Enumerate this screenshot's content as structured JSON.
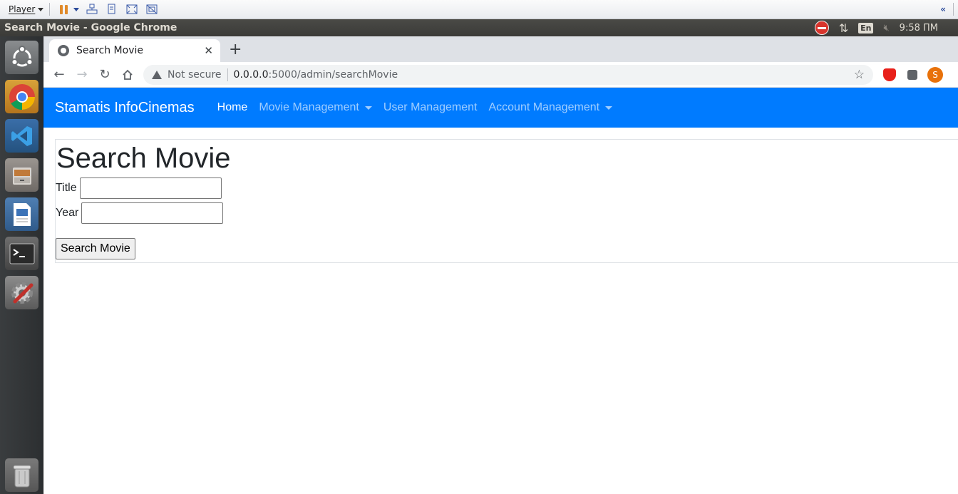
{
  "player": {
    "menu_label": "Player"
  },
  "topbar": {
    "window_title": "Search Movie - Google Chrome",
    "lang": "En",
    "clock": "9:58 ПМ"
  },
  "browser": {
    "tab_title": "Search Movie",
    "security_label": "Not secure",
    "url_host": "0.0.0.0",
    "url_rest": ":5000/admin/searchMovie",
    "profile_initial": "S"
  },
  "site": {
    "brand": "Stamatis InfoCinemas",
    "nav": [
      {
        "label": "Home",
        "active": true,
        "dropdown": false
      },
      {
        "label": "Movie Management",
        "active": false,
        "dropdown": true
      },
      {
        "label": "User Management",
        "active": false,
        "dropdown": false
      },
      {
        "label": "Account Management",
        "active": false,
        "dropdown": true
      }
    ]
  },
  "form": {
    "heading": "Search Movie",
    "title_label": "Title",
    "title_value": "",
    "year_label": "Year",
    "year_value": "",
    "submit_label": "Search Movie"
  },
  "colors": {
    "navbar": "#007bff",
    "launcher": "#2c2f31",
    "topbar": "#3c3b37"
  }
}
